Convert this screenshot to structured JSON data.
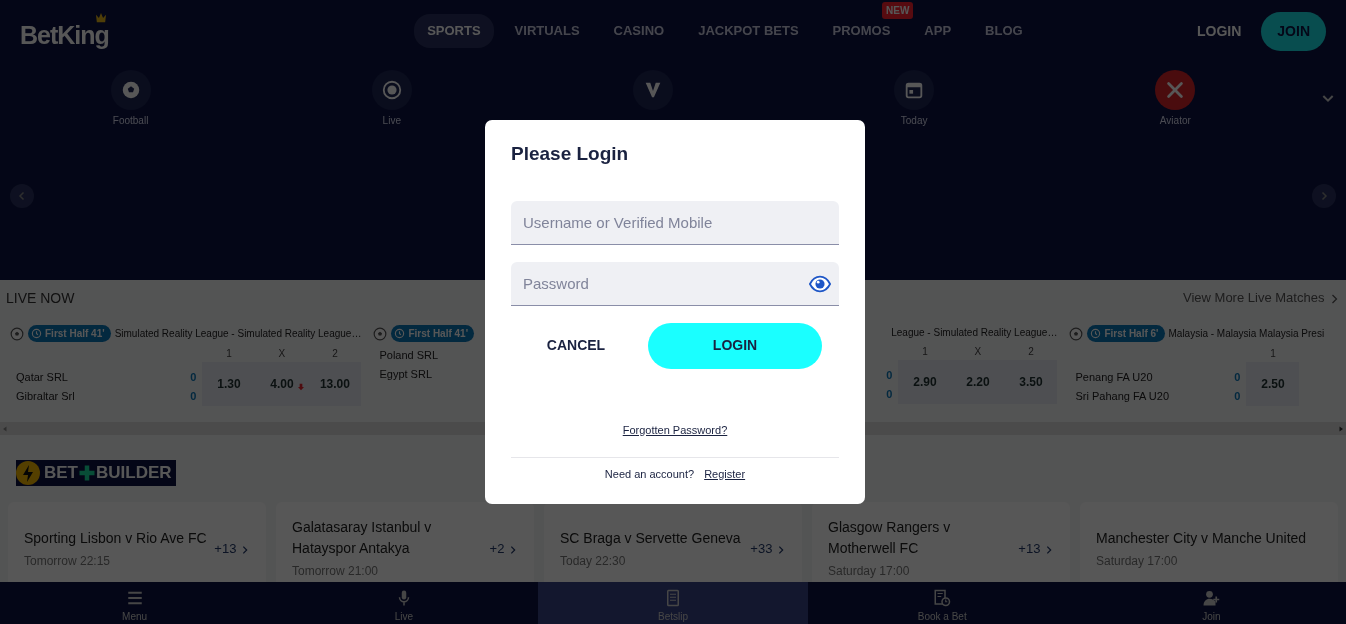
{
  "nav": {
    "logo": "BetKing",
    "links": [
      {
        "label": "SPORTS",
        "selected": true
      },
      {
        "label": "VIRTUALS",
        "selected": false
      },
      {
        "label": "CASINO",
        "selected": false
      },
      {
        "label": "JACKPOT BETS",
        "selected": false
      },
      {
        "label": "PROMOS",
        "selected": false,
        "badge": "NEW"
      },
      {
        "label": "APP",
        "selected": false
      },
      {
        "label": "BLOG",
        "selected": false
      }
    ],
    "login": "LOGIN",
    "join": "JOIN"
  },
  "quick_links": [
    {
      "label": "Football",
      "kind": "football"
    },
    {
      "label": "Live",
      "kind": "live"
    },
    {
      "kind": "virtuals"
    },
    {
      "label": "Today",
      "kind": "today"
    },
    {
      "label": "Aviator",
      "kind": "aviator"
    }
  ],
  "live": {
    "title": "LIVE NOW",
    "more": "View More Live Matches",
    "matches": [
      {
        "status": "First Half 41'",
        "league": "Simulated Reality League - Simulated Reality League…",
        "headers": [
          "1",
          "X",
          "2"
        ],
        "teams": [
          {
            "name": "Qatar SRL",
            "score": "0"
          },
          {
            "name": "Gibraltar Srl",
            "score": "0"
          }
        ],
        "odds": [
          {
            "value": "1.30",
            "falling": false
          },
          {
            "value": "4.00",
            "falling": true
          },
          {
            "value": "13.00",
            "falling": false
          }
        ]
      },
      {
        "status": "First Half 41'",
        "teams": [
          {
            "name": "Poland SRL"
          },
          {
            "name": "Egypt SRL"
          }
        ]
      },
      {
        "league": "League - Simulated Reality League…",
        "headers": [
          "1",
          "X",
          "2"
        ],
        "teams": [
          {
            "score": "0"
          },
          {
            "score": "0"
          }
        ],
        "odds": [
          {
            "value": "2.90",
            "falling": false
          },
          {
            "value": "2.20",
            "falling": false
          },
          {
            "value": "3.50",
            "falling": false
          }
        ]
      },
      {
        "status": "First Half 6'",
        "league": "Malaysia - Malaysia Malaysia Presi",
        "headers": [
          "1"
        ],
        "teams": [
          {
            "name": "Penang FA U20",
            "score": "0"
          },
          {
            "name": "Sri Pahang FA U20",
            "score": "0"
          }
        ],
        "odds": [
          {
            "value": "2.50",
            "falling": false
          }
        ]
      }
    ]
  },
  "bet_builder": {
    "logo": [
      "BET",
      "BUILDER"
    ],
    "matches": [
      {
        "title": "Sporting Lisbon v Rio Ave FC",
        "time": "Tomorrow 22:15",
        "more": "+13"
      },
      {
        "title": "Galatasaray Istanbul v Hatayspor Antakya",
        "time": "Tomorrow 21:00",
        "more": "+2"
      },
      {
        "title": "SC Braga v Servette Geneva",
        "time": "Today 22:30",
        "more": "+33"
      },
      {
        "title": "Glasgow Rangers v Motherwell FC",
        "time": "Saturday 17:00",
        "more": "+13"
      },
      {
        "title": "Manchester City v Manche United",
        "time": "Saturday 17:00"
      }
    ]
  },
  "bottom_nav": [
    {
      "label": "Menu",
      "kind": "menu",
      "selected": false
    },
    {
      "label": "Live",
      "kind": "live",
      "selected": false
    },
    {
      "label": "Betslip",
      "kind": "betslip",
      "selected": true
    },
    {
      "label": "Book a Bet",
      "kind": "book",
      "selected": false
    },
    {
      "label": "Join",
      "kind": "join",
      "selected": false
    }
  ],
  "login_dialog": {
    "title": "Please Login",
    "username": {
      "placeholder": "Username or Verified Mobile"
    },
    "password": {
      "placeholder": "Password"
    },
    "cancel": "CANCEL",
    "login": "LOGIN",
    "forgot": "Forgotten Password?",
    "need_account": "Need an account?",
    "register": "Register"
  }
}
